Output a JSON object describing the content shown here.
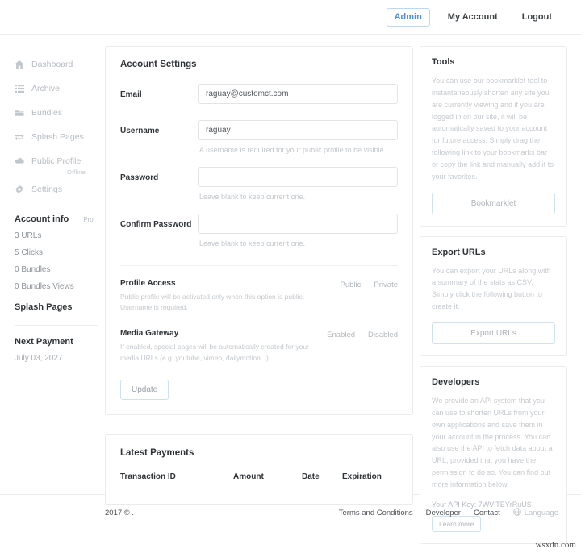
{
  "topnav": {
    "items": [
      {
        "label": "Admin",
        "active": true
      },
      {
        "label": "My Account",
        "active": false
      },
      {
        "label": "Logout",
        "active": false
      }
    ]
  },
  "sidebar": {
    "nav": [
      {
        "label": "Dashboard",
        "icon": "home-icon"
      },
      {
        "label": "Archive",
        "icon": "list-icon"
      },
      {
        "label": "Bundles",
        "icon": "folder-icon"
      },
      {
        "label": "Splash Pages",
        "icon": "swap-arrows-icon"
      },
      {
        "label": "Public Profile",
        "icon": "cloud-icon",
        "sub": "Offline"
      },
      {
        "label": "Settings",
        "icon": "gear-icon"
      }
    ],
    "account_info": {
      "title": "Account info",
      "badge": "Pro",
      "stats": [
        "3 URLs",
        "5 Clicks",
        "0 Bundles",
        "0 Bundles Views"
      ]
    },
    "splash_pages_title": "Splash Pages",
    "next_payment": {
      "title": "Next Payment",
      "date": "July 03, 2027"
    }
  },
  "account_settings": {
    "title": "Account Settings",
    "email": {
      "label": "Email",
      "value": "raguay@customct.com",
      "placeholder": "Email"
    },
    "username": {
      "label": "Username",
      "value": "raguay",
      "placeholder": "Username",
      "hint": "A username is required for your public profile to be visible."
    },
    "password": {
      "label": "Password",
      "value": "",
      "placeholder": "",
      "hint": "Leave blank to keep current one."
    },
    "confirm_password": {
      "label": "Confirm Password",
      "value": "",
      "placeholder": "",
      "hint": "Leave blank to keep current one."
    },
    "profile_access": {
      "title": "Profile Access",
      "desc": "Public profile will be activated only when this option is public. Username is required.",
      "options": [
        "Public",
        "Private"
      ]
    },
    "media_gateway": {
      "title": "Media Gateway",
      "desc": "If enabled, special pages will be automatically created for your media URLs (e.g. youtube, vimeo, dailymotion...)",
      "options": [
        "Enabled",
        "Disabled"
      ]
    },
    "update_label": "Update"
  },
  "latest_payments": {
    "title": "Latest Payments",
    "columns": [
      "Transaction ID",
      "Amount",
      "Date",
      "Expiration"
    ],
    "rows": []
  },
  "tools": {
    "title": "Tools",
    "text": "You can use our bookmarklet tool to instantaneously shorten any site you are currently viewing and if you are logged in on our site, it will be automatically saved to your account for future access. Simply drag the following link to your bookmarks bar or copy the link and manually add it to your favorites.",
    "button": "Bookmarklet"
  },
  "export_urls": {
    "title": "Export URLs",
    "text": "You can export your URLs along with a summary of the stats as CSV. Simply click the following button to create it.",
    "button": "Export URLs"
  },
  "developers": {
    "title": "Developers",
    "text": "We provide an API system that you can use to shorten URLs from your own applications and save them in your account in the process. You can also use the API to fetch data about a URL, provided that you have the permission to do so. You can find out more information below.",
    "api_key": "Your API Key: 7WVlTEYrRuUS",
    "button": "Learn more"
  },
  "footer": {
    "copyright": "2017 © .",
    "links": [
      "Terms and Conditions",
      "Developer",
      "Contact"
    ],
    "language": "Language"
  },
  "watermark": "wsxdn.com",
  "colors": {
    "accent": "#4a90e2",
    "border_blue": "#cfe0f0",
    "muted": "#c4c8cc"
  }
}
